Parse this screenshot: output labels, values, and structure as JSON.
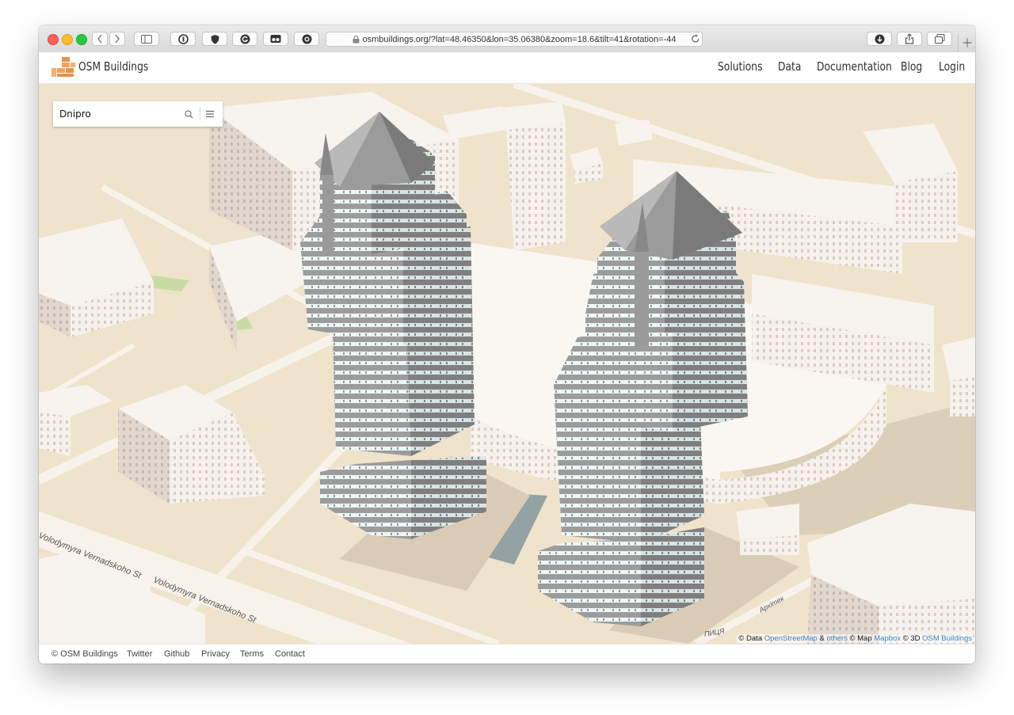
{
  "browser": {
    "url": "osmbuildings.org/?lat=48.46350&lon=35.06380&zoom=18.6&tilt=41&rotation=-44",
    "traffic_lights": {
      "close": "#ff5f57",
      "minimize": "#febc2e",
      "maximize": "#28c840"
    }
  },
  "navbar": {
    "brand": "OSM Buildings",
    "links": [
      "Solutions",
      "Data",
      "Documentation",
      "Blog",
      "Login"
    ]
  },
  "search": {
    "value": "Dnipro"
  },
  "map": {
    "street_labels": [
      "Volodymyra Vernadskoho St",
      "Volodymyra Vernadskoho St",
      "Архітек",
      "ПИЦЯ"
    ]
  },
  "attribution": {
    "data_prefix": "© Data",
    "osm_link": "OpenStreetMap",
    "amp": "&",
    "others_link": "others",
    "map_prefix": "© Map",
    "mapbox_link": "Mapbox",
    "threed_prefix": "© 3D",
    "osmb_link": "OSM Buildings"
  },
  "footer": {
    "copyright": "© OSM Buildings",
    "links": [
      "Twitter",
      "Github",
      "Privacy",
      "Terms",
      "Contact"
    ]
  },
  "colors": {
    "brand_orange": "#f2a15b",
    "link_blue": "#3b7fc4",
    "map_ground": "#efe3cc"
  }
}
